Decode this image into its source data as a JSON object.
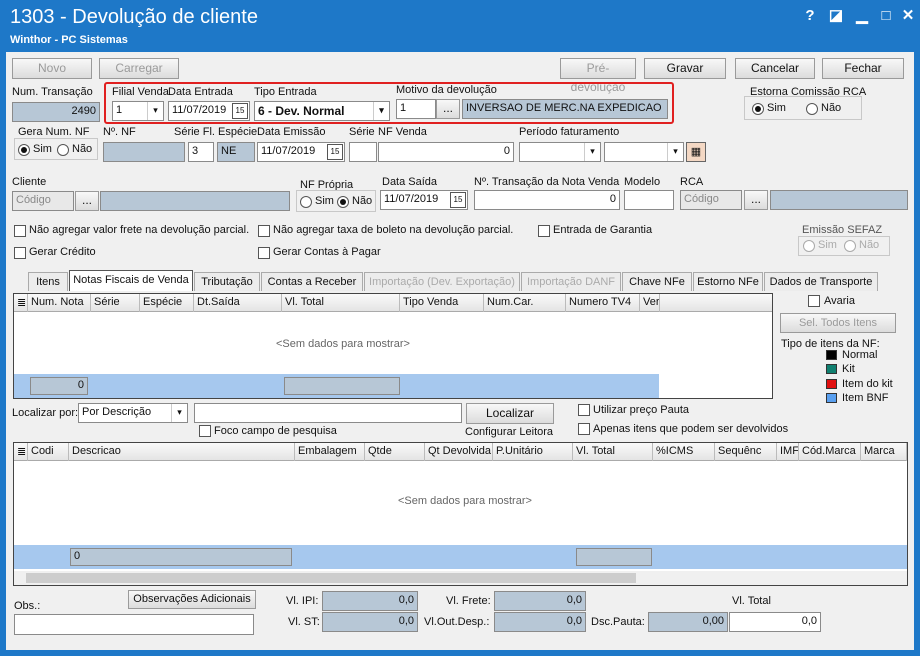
{
  "window": {
    "title": "1303 - Devolução de cliente",
    "subtitle": "Winthor - PC Sistemas",
    "buttons": [
      "?",
      "◪",
      "▁",
      "□",
      "✕"
    ]
  },
  "toolbar": {
    "novo": "Novo",
    "carregar": "Carregar",
    "pre_devolucao": "Pré-devolução",
    "gravar": "Gravar",
    "cancelar": "Cancelar",
    "fechar": "Fechar"
  },
  "header": {
    "num_transacao_label": "Num. Transação",
    "num_transacao_value": "2490",
    "filial_venda_label": "Filial Venda",
    "filial_venda_value": "1",
    "data_entrada_label": "Data Entrada",
    "data_entrada_value": "11/07/2019",
    "tipo_entrada_label": "Tipo Entrada",
    "tipo_entrada_value": "6 - Dev. Normal",
    "motivo_label": "Motivo da devolução",
    "motivo_code": "1",
    "motivo_desc": "INVERSAO DE MERC.NA EXPEDICAO",
    "ellipsis": "...",
    "estorna_label": "Estorna Comissão RCA",
    "sim": "Sim",
    "nao": "Não"
  },
  "row2": {
    "gera_num_nf_label": "Gera Num. NF",
    "num_nf_label": "Nº. NF",
    "serie_fl_especie_label": "Série Fl. Espécie",
    "serie_fl_value": "3",
    "especie_value": "NE",
    "data_emissao_label": "Data Emissão",
    "data_emissao_value": "11/07/2019",
    "serie_label": "Série",
    "nf_venda_label": "NF Venda",
    "nf_venda_value": "0",
    "periodo_label": "Período faturamento"
  },
  "row3": {
    "cliente_label": "Cliente",
    "cliente_placeholder": "Código",
    "nf_propria_label": "NF Própria",
    "data_saida_label": "Data Saída",
    "data_saida_value": "11/07/2019",
    "num_trans_nota_venda_label": "Nº. Transação da Nota Venda",
    "num_trans_nota_venda_value": "0",
    "modelo_label": "Modelo",
    "rca_label": "RCA",
    "rca_placeholder": "Código"
  },
  "options": {
    "nao_agregar_frete": "Não agregar valor frete na devolução parcial.",
    "nao_agregar_boleto": "Não agregar taxa de boleto na devolução parcial.",
    "entrada_garantia": "Entrada de Garantia",
    "gerar_credito": "Gerar Crédito",
    "gerar_contas_pagar": "Gerar Contas à Pagar",
    "emissao_sefaz_label": "Emissão SEFAZ"
  },
  "tabs": [
    {
      "label": "Itens",
      "state": "normal"
    },
    {
      "label": "Notas Fiscais de Venda",
      "state": "active"
    },
    {
      "label": "Tributação",
      "state": "normal"
    },
    {
      "label": "Contas a Receber",
      "state": "normal"
    },
    {
      "label": "Importação (Dev. Exportação)",
      "state": "disabled"
    },
    {
      "label": "Importação DANF",
      "state": "disabled"
    },
    {
      "label": "Chave NFe",
      "state": "normal"
    },
    {
      "label": "Estorno NFe",
      "state": "normal"
    },
    {
      "label": "Dados de Transporte",
      "state": "normal"
    }
  ],
  "grid1": {
    "columns": [
      "Num. Nota",
      "Série",
      "Espécie",
      "Dt.Saída",
      "Vl. Total",
      "Tipo Venda",
      "Num.Car.",
      "Numero TV4",
      "Ver"
    ],
    "empty": "<Sem dados para mostrar>",
    "footer_count": "0"
  },
  "side": {
    "avaria": "Avaria",
    "sel_todos": "Sel. Todos Itens",
    "tipo_itens_label": "Tipo de itens da NF:",
    "legend": [
      {
        "label": "Normal",
        "color": "#000000"
      },
      {
        "label": "Kit",
        "color": "#108070"
      },
      {
        "label": "Item do kit",
        "color": "#e01010"
      },
      {
        "label": "Item BNF",
        "color": "#5aa0f0"
      }
    ]
  },
  "search": {
    "localizar_por_label": "Localizar por:",
    "localizar_por_value": "Por Descrição",
    "localizar_btn": "Localizar",
    "foco_campo": "Foco campo de pesquisa",
    "configurar_leitora": "Configurar Leitora",
    "utilizar_preco_pauta": "Utilizar preço Pauta",
    "apenas_itens": "Apenas itens que podem ser devolvidos"
  },
  "grid2": {
    "columns": [
      "Codi",
      "Descricao",
      "Embalagem",
      "Qtde",
      "Qt Devolvida",
      "P.Unitário",
      "Vl. Total",
      "%ICMS",
      "Sequênc",
      "IMF",
      "Cód.Marca",
      "Marca"
    ],
    "empty": "<Sem dados para mostrar>",
    "footer_count": "0"
  },
  "bottom": {
    "obs_label": "Obs.:",
    "obs_adicionais": "Observações Adicionais",
    "vl_ipi_label": "Vl. IPI:",
    "vl_ipi": "0,0",
    "vl_st_label": "Vl. ST:",
    "vl_st": "0,0",
    "vl_frete_label": "Vl. Frete:",
    "vl_frete": "0,0",
    "vl_out_desp_label": "Vl.Out.Desp.:",
    "vl_out_desp": "0,0",
    "dsc_pauta_label": "Dsc.Pauta:",
    "dsc_pauta": "0,00",
    "vl_total_label": "Vl. Total",
    "vl_total": "0,0"
  }
}
